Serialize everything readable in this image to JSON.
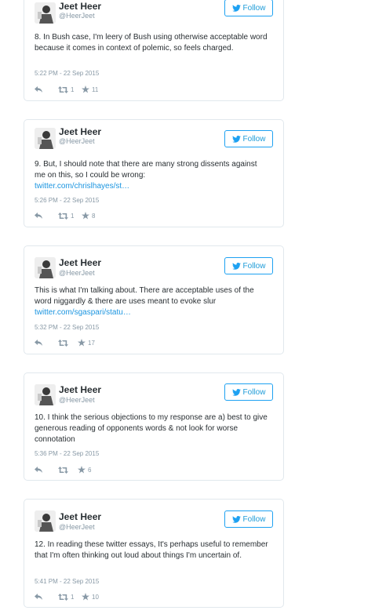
{
  "brand_color": "#1da1f2",
  "tweets": [
    {
      "name": "Jeet Heer",
      "handle": "@HeerJeet",
      "follow_label": "Follow",
      "text": "8. In Bush case, I'm leery of Bush using otherwise acceptable word because it comes in context of polemic, so feels charged.",
      "link": "",
      "time": "5:22 PM - 22 Sep 2015",
      "retweets": "1",
      "favorites": "11"
    },
    {
      "name": "Jeet Heer",
      "handle": "@HeerJeet",
      "follow_label": "Follow",
      "text": "9. But, I should note that there are many strong dissents against me on this, so I could be wrong:",
      "link": "twitter.com/chrislhayes/st…",
      "time": "5:26 PM - 22 Sep 2015",
      "retweets": "1",
      "favorites": "8"
    },
    {
      "name": "Jeet Heer",
      "handle": "@HeerJeet",
      "follow_label": "Follow",
      "text": "This is what I'm talking about. There are acceptable uses of the word niggardly & there are uses meant to evoke slur",
      "link": "twitter.com/sgaspari/statu…",
      "time": "5:32 PM - 22 Sep 2015",
      "retweets": "",
      "favorites": "17"
    },
    {
      "name": "Jeet Heer",
      "handle": "@HeerJeet",
      "follow_label": "Follow",
      "text": "10. I think the serious objections to my response are a) best to give generous reading of opponents words & not look for worse connotation",
      "link": "",
      "time": "5:36 PM - 22 Sep 2015",
      "retweets": "",
      "favorites": "6"
    },
    {
      "name": "Jeet Heer",
      "handle": "@HeerJeet",
      "follow_label": "Follow",
      "text": "12. In reading these twitter essays, It's perhaps useful to remember that I'm often thinking out loud about things I'm uncertain of.",
      "link": "",
      "time": "5:41 PM - 22 Sep 2015",
      "retweets": "1",
      "favorites": "10"
    }
  ]
}
